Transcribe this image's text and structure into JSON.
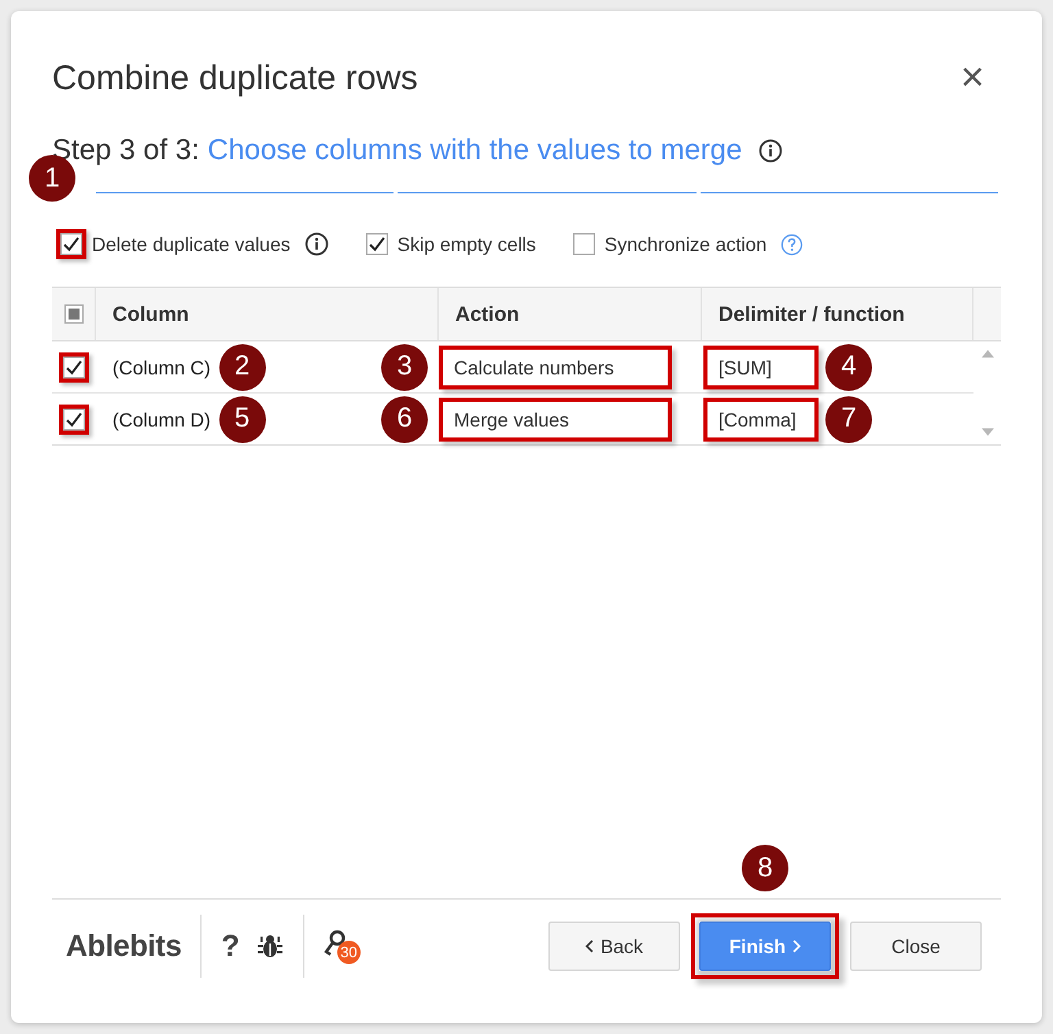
{
  "dialog": {
    "title": "Combine duplicate rows",
    "close": "×"
  },
  "step": {
    "prefix": "Step 3 of 3:",
    "title": "Choose columns with the values to merge"
  },
  "steps": [
    {
      "done": true
    },
    {
      "done": true
    },
    {
      "done": true
    }
  ],
  "options": [
    {
      "label": "Delete duplicate values",
      "checked": true,
      "highlighted": true,
      "callout": "1",
      "info": true,
      "help": false
    },
    {
      "label": "Skip empty cells",
      "checked": true,
      "highlighted": false,
      "info": false,
      "help": false
    },
    {
      "label": "Synchronize action",
      "checked": false,
      "highlighted": false,
      "info": false,
      "help": true
    }
  ],
  "table": {
    "select_all": {
      "indeterminate": true
    },
    "columns": [
      "Column",
      "Action",
      "Delimiter / function"
    ],
    "rows": [
      {
        "checked": true,
        "highlighted": true,
        "column": "(Column C)",
        "column_callout": "2",
        "action": "Calculate numbers",
        "action_callout": "3",
        "delimiter": "[SUM]",
        "delimiter_callout": "4"
      },
      {
        "checked": true,
        "highlighted": true,
        "column": "(Column D)",
        "column_callout": "5",
        "action": "Merge values",
        "action_callout": "6",
        "delimiter": "[Comma]",
        "delimiter_callout": "7"
      }
    ]
  },
  "footer": {
    "brand": "Ablebits",
    "help": "?",
    "notification_count": "30",
    "buttons": [
      {
        "kind": "back",
        "label": "Back",
        "highlighted": false
      },
      {
        "kind": "primary",
        "label": "Finish",
        "highlighted": true,
        "callout": "8"
      },
      {
        "kind": "plain",
        "label": "Close",
        "highlighted": false
      }
    ]
  }
}
